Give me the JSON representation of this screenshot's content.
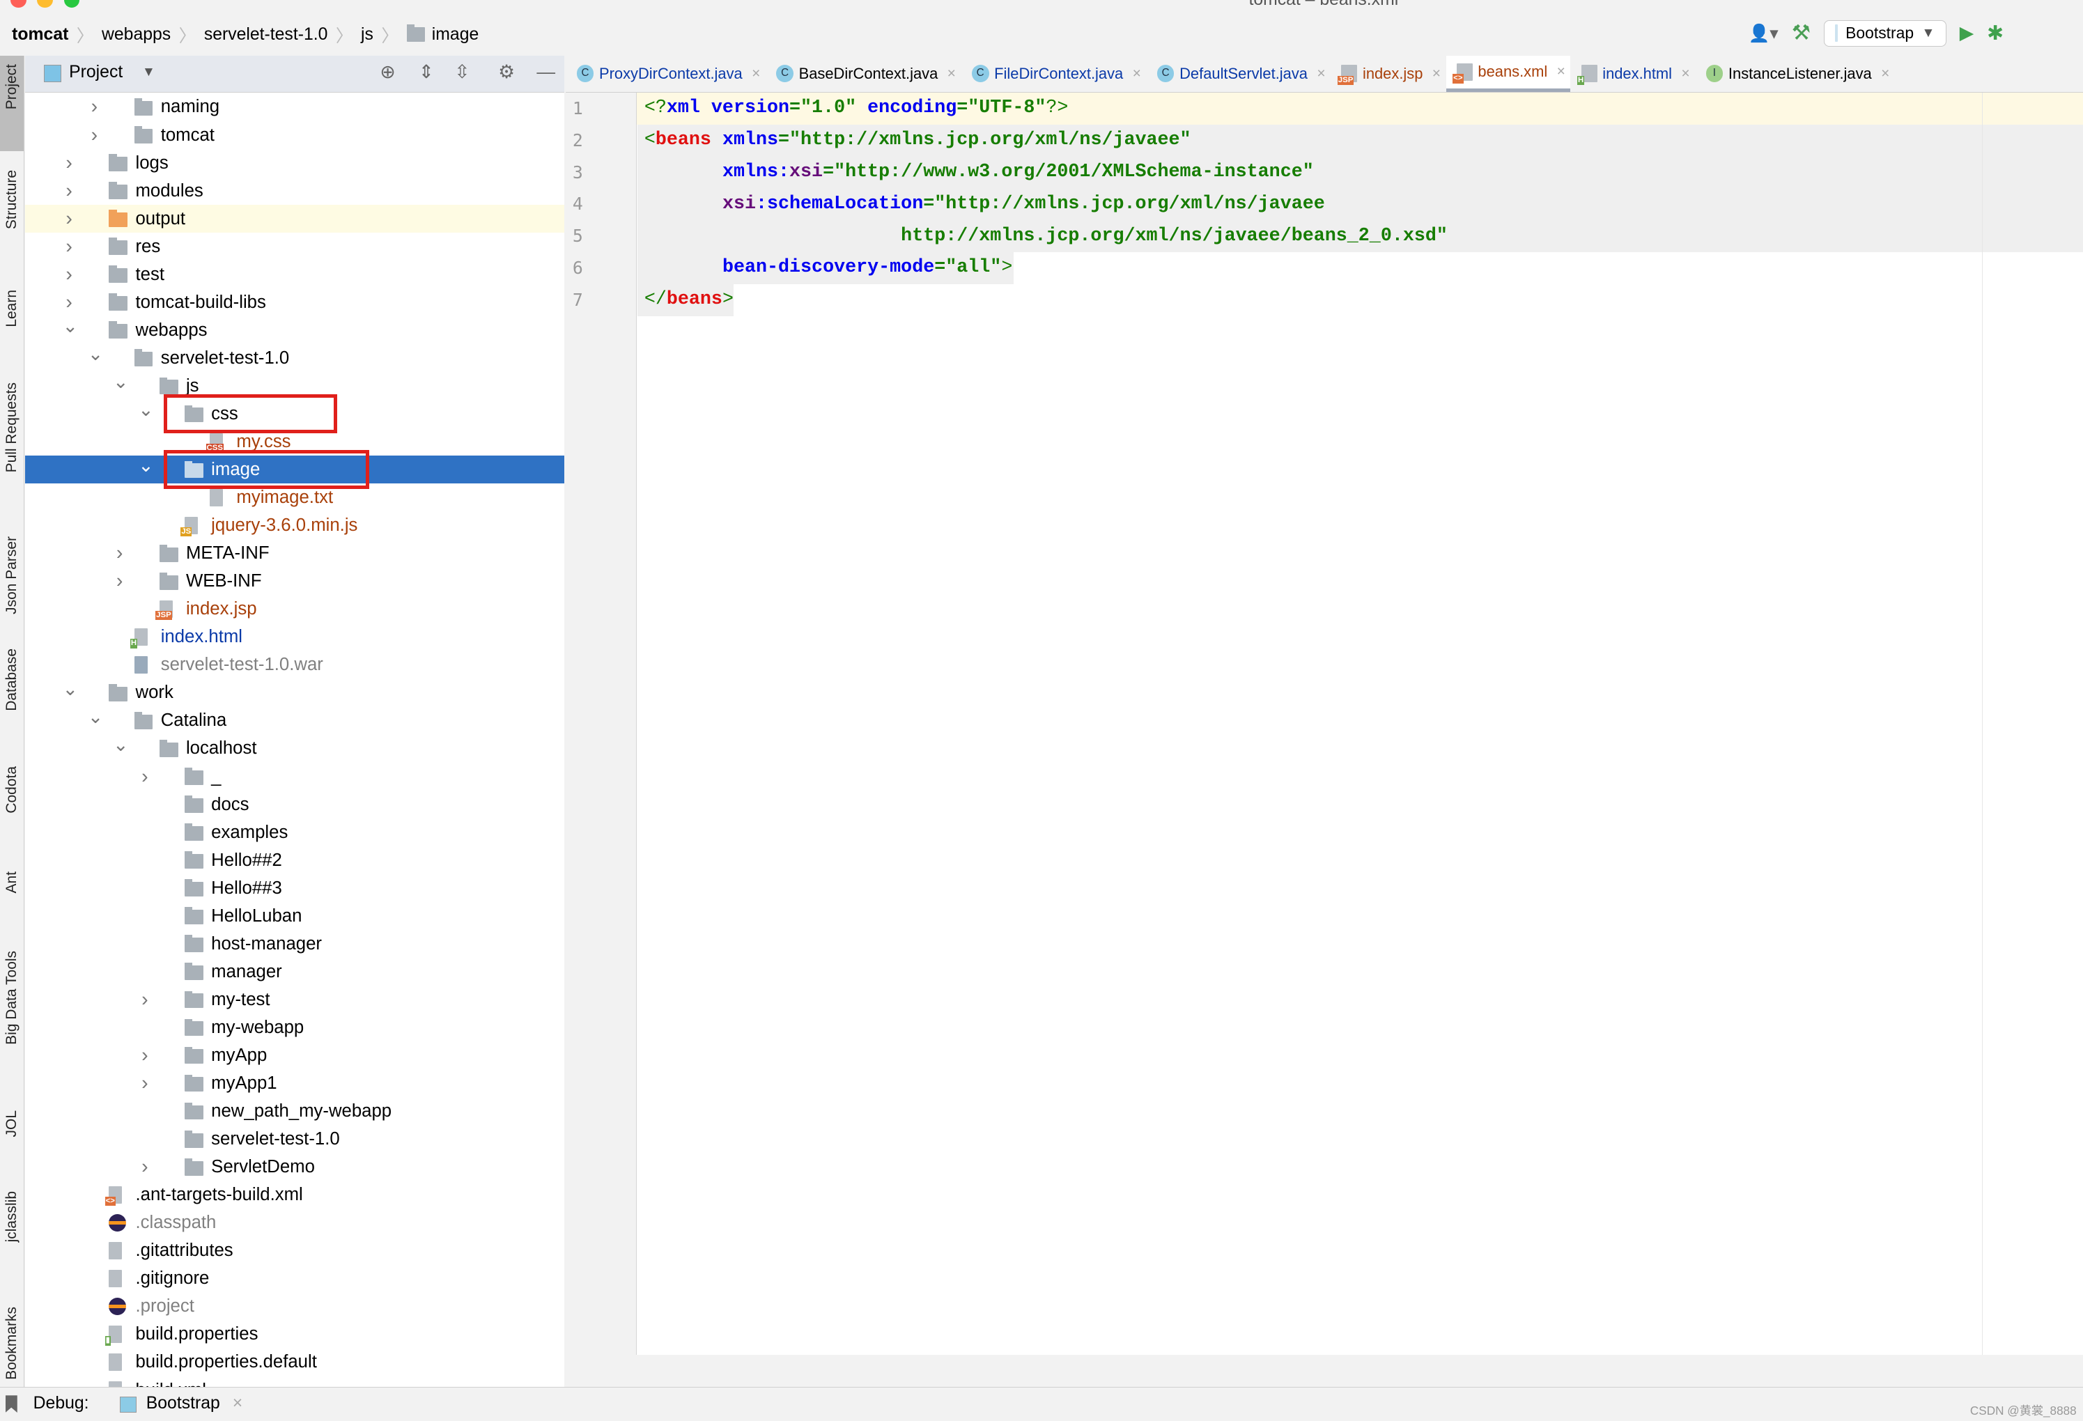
{
  "window": {
    "title": "tomcat – beans.xml"
  },
  "breadcrumb": [
    "tomcat",
    "webapps",
    "servelet-test-1.0",
    "js",
    "image"
  ],
  "toolbar": {
    "run_config": "Bootstrap"
  },
  "left_stripe": [
    "Project",
    "Structure",
    "Learn",
    "Pull Requests",
    "Json Parser",
    "Database",
    "Codota",
    "Ant",
    "Big Data Tools",
    "JOL",
    "jclasslib",
    "Bookmarks"
  ],
  "project_panel": {
    "title": "Project"
  },
  "tree": [
    {
      "label": "naming",
      "depth": 2,
      "kind": "folder",
      "arrow": "right"
    },
    {
      "label": "tomcat",
      "depth": 2,
      "kind": "folder",
      "arrow": "right"
    },
    {
      "label": "logs",
      "depth": 1,
      "kind": "folder",
      "arrow": "right"
    },
    {
      "label": "modules",
      "depth": 1,
      "kind": "folder",
      "arrow": "right"
    },
    {
      "label": "output",
      "depth": 1,
      "kind": "folder-orange",
      "arrow": "right",
      "highlight": true
    },
    {
      "label": "res",
      "depth": 1,
      "kind": "folder",
      "arrow": "right"
    },
    {
      "label": "test",
      "depth": 1,
      "kind": "folder",
      "arrow": "right"
    },
    {
      "label": "tomcat-build-libs",
      "depth": 1,
      "kind": "folder",
      "arrow": "right"
    },
    {
      "label": "webapps",
      "depth": 1,
      "kind": "folder",
      "arrow": "down"
    },
    {
      "label": "servelet-test-1.0",
      "depth": 2,
      "kind": "folder",
      "arrow": "down"
    },
    {
      "label": "js",
      "depth": 3,
      "kind": "folder",
      "arrow": "down"
    },
    {
      "label": "css",
      "depth": 4,
      "kind": "folder",
      "arrow": "down",
      "boxed": true
    },
    {
      "label": "my.css",
      "depth": 5,
      "kind": "css",
      "color": "#a8400a"
    },
    {
      "label": "image",
      "depth": 4,
      "kind": "folder",
      "arrow": "down",
      "selected": true,
      "boxed": true
    },
    {
      "label": "myimage.txt",
      "depth": 5,
      "kind": "txt",
      "color": "#a8400a"
    },
    {
      "label": "jquery-3.6.0.min.js",
      "depth": 4,
      "kind": "js",
      "color": "#a8400a"
    },
    {
      "label": "META-INF",
      "depth": 3,
      "kind": "folder",
      "arrow": "right"
    },
    {
      "label": "WEB-INF",
      "depth": 3,
      "kind": "folder",
      "arrow": "right"
    },
    {
      "label": "index.jsp",
      "depth": 3,
      "kind": "jsp",
      "color": "#a8400a"
    },
    {
      "label": "index.html",
      "depth": 2,
      "kind": "html",
      "color": "#0b3aa8"
    },
    {
      "label": "servelet-test-1.0.war",
      "depth": 2,
      "kind": "war",
      "color": "#808080"
    },
    {
      "label": "work",
      "depth": 1,
      "kind": "folder",
      "arrow": "down"
    },
    {
      "label": "Catalina",
      "depth": 2,
      "kind": "folder",
      "arrow": "down"
    },
    {
      "label": "localhost",
      "depth": 3,
      "kind": "folder",
      "arrow": "down"
    },
    {
      "label": "_",
      "depth": 4,
      "kind": "folder",
      "arrow": "right"
    },
    {
      "label": "docs",
      "depth": 4,
      "kind": "folder"
    },
    {
      "label": "examples",
      "depth": 4,
      "kind": "folder"
    },
    {
      "label": "Hello##2",
      "depth": 4,
      "kind": "folder"
    },
    {
      "label": "Hello##3",
      "depth": 4,
      "kind": "folder"
    },
    {
      "label": "HelloLuban",
      "depth": 4,
      "kind": "folder"
    },
    {
      "label": "host-manager",
      "depth": 4,
      "kind": "folder"
    },
    {
      "label": "manager",
      "depth": 4,
      "kind": "folder"
    },
    {
      "label": "my-test",
      "depth": 4,
      "kind": "folder",
      "arrow": "right"
    },
    {
      "label": "my-webapp",
      "depth": 4,
      "kind": "folder"
    },
    {
      "label": "myApp",
      "depth": 4,
      "kind": "folder",
      "arrow": "right"
    },
    {
      "label": "myApp1",
      "depth": 4,
      "kind": "folder",
      "arrow": "right"
    },
    {
      "label": "new_path_my-webapp",
      "depth": 4,
      "kind": "folder"
    },
    {
      "label": "servelet-test-1.0",
      "depth": 4,
      "kind": "folder"
    },
    {
      "label": "ServletDemo",
      "depth": 4,
      "kind": "folder",
      "arrow": "right"
    },
    {
      "label": ".ant-targets-build.xml",
      "depth": 1,
      "kind": "xml"
    },
    {
      "label": ".classpath",
      "depth": 1,
      "kind": "eclipse",
      "color": "#808080"
    },
    {
      "label": ".gitattributes",
      "depth": 1,
      "kind": "file"
    },
    {
      "label": ".gitignore",
      "depth": 1,
      "kind": "file"
    },
    {
      "label": ".project",
      "depth": 1,
      "kind": "eclipse",
      "color": "#808080"
    },
    {
      "label": "build.properties",
      "depth": 1,
      "kind": "props"
    },
    {
      "label": "build.properties.default",
      "depth": 1,
      "kind": "file"
    },
    {
      "label": "build.xml",
      "depth": 1,
      "kind": "xml"
    }
  ],
  "tabs": [
    {
      "label": "ProxyDirContext.java",
      "icon": "C",
      "color": "#0b3aa8"
    },
    {
      "label": "BaseDirContext.java",
      "icon": "C",
      "color": "#000000"
    },
    {
      "label": "FileDirContext.java",
      "icon": "C",
      "color": "#0b3aa8"
    },
    {
      "label": "DefaultServlet.java",
      "icon": "C",
      "color": "#0b3aa8"
    },
    {
      "label": "index.jsp",
      "icon": "JSP",
      "color": "#a8400a"
    },
    {
      "label": "beans.xml",
      "icon": "XML",
      "color": "#a8400a",
      "active": true
    },
    {
      "label": "index.html",
      "icon": "H",
      "color": "#0b3aa8"
    },
    {
      "label": "InstanceListener.java",
      "icon": "I",
      "color": "#000000"
    }
  ],
  "editor": {
    "line_numbers": [
      "1",
      "2",
      "3",
      "4",
      "5",
      "6",
      "7"
    ],
    "lines": [
      [
        [
          "pn",
          "<?"
        ],
        [
          "at",
          "xml "
        ],
        [
          "at",
          "version"
        ],
        [
          "vl",
          "=\"1.0\" "
        ],
        [
          "at",
          "encoding"
        ],
        [
          "vl",
          "=\"UTF-8\""
        ],
        [
          "pn",
          "?>"
        ]
      ],
      [
        [
          "pn",
          "<"
        ],
        [
          "tg",
          "beans "
        ],
        [
          "at",
          "xmlns"
        ],
        [
          "vl",
          "=\"http://xmlns.jcp.org/xml/ns/javaee\""
        ]
      ],
      [
        [
          "vl",
          "       "
        ],
        [
          "at",
          "xmlns:"
        ],
        [
          "ns",
          "xsi"
        ],
        [
          "vl",
          "=\"http://www.w3.org/2001/XMLSchema-instance\""
        ]
      ],
      [
        [
          "vl",
          "       "
        ],
        [
          "ns",
          "xsi"
        ],
        [
          "at",
          ":schemaLocation"
        ],
        [
          "vl",
          "=\"http://xmlns.jcp.org/xml/ns/javaee"
        ]
      ],
      [
        [
          "vl",
          "                       http://xmlns.jcp.org/xml/ns/javaee/beans_2_0.xsd\""
        ]
      ],
      [
        [
          "vl",
          "       "
        ],
        [
          "at",
          "bean-discovery-mode"
        ],
        [
          "vl",
          "=\"all\""
        ],
        [
          "pn",
          ">"
        ]
      ],
      [
        [
          "pn",
          "</"
        ],
        [
          "tg",
          "beans"
        ],
        [
          "pn",
          ">"
        ]
      ]
    ]
  },
  "statusbar": {
    "debug_label": "Debug:",
    "session": "Bootstrap"
  },
  "watermark": "CSDN @黄裳_8888"
}
